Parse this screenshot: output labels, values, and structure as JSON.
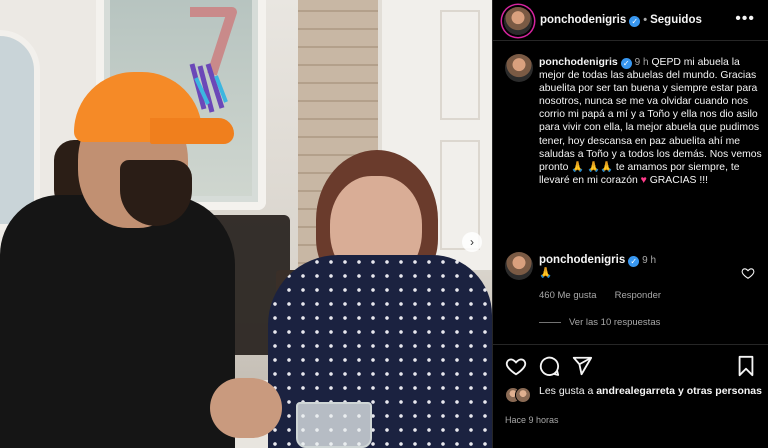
{
  "post": {
    "next_glyph": "›"
  },
  "header": {
    "username": "ponchodenigris",
    "separator": "•",
    "follow_status": "Seguidos",
    "more_glyph": "•••"
  },
  "caption": {
    "username": "ponchodenigris",
    "time": "9 h",
    "text_before_heart": "QEPD mi abuela la mejor de todas las abuelas del mundo. Gracias abuelita por ser tan buena y siempre estar para nosotros, nunca se me va olvidar cuando nos corrio mi papá a mí y a Toño y ella nos dio asilo para vivir con ella, la mejor abuela que pudimos tener, hoy descansa en paz abuelita ahí me saludas a Toño y a todos los demás. Nos vemos pronto 🙏 🙏🙏 te amamos por siempre, te llevaré en mi corazón",
    "heart": "♥",
    "text_after_heart": "GRACIAS !!!"
  },
  "comment": {
    "username": "ponchodenigris",
    "time": "9 h",
    "text": "🙏",
    "likes": "460 Me gusta",
    "reply": "Responder"
  },
  "replies": {
    "label": "Ver las 10 respuestas"
  },
  "likes": {
    "prefix": "Les gusta a",
    "user": "andrealegarreta",
    "suffix": "y otras personas"
  },
  "posted_ago": "Hace 9 horas",
  "colors": {
    "background": "#000000",
    "text": "#f5f5f5",
    "muted": "#a8a8a8",
    "verified": "#3897f0",
    "heart": "#ff3b8a"
  }
}
